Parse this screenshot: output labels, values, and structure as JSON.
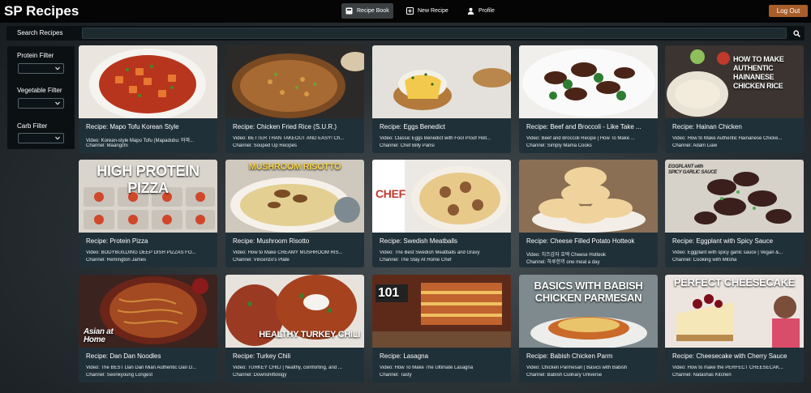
{
  "app": {
    "title": "SP Recipes"
  },
  "nav": {
    "recipe_book": "Recipe Book",
    "new_recipe": "New Recipe",
    "profile": "Profile",
    "logout": "Log Out"
  },
  "search": {
    "label": "Search Recipes",
    "value": "",
    "placeholder": ""
  },
  "filters": [
    {
      "label": "Protein Filter",
      "value": ""
    },
    {
      "label": "Vegetable Filter",
      "value": ""
    },
    {
      "label": "Carb Filter",
      "value": ""
    }
  ],
  "colors": {
    "header": "#050505",
    "panel": "#0b1013",
    "card_info": "#203039",
    "logout": "#a85e2a",
    "active_nav": "#3a3f42"
  },
  "recipes": [
    {
      "title": "Recipe: Mapo Tofu Korean Style",
      "video": "Video: Korean-style Mapo Tofu (Mapadubu: 마파...",
      "channel": "Channel: Maangchi",
      "thumb_text": ""
    },
    {
      "title": "Recipe: Chicken Fried Rice (S.U.R.)",
      "video": "Video: BETTER THAN TAKEOUT AND EASY! Ch...",
      "channel": "Channel: Souped Up Recipes",
      "thumb_text": ""
    },
    {
      "title": "Recipe: Eggs Benedict",
      "video": "Video: Classic Eggs Benedict with Fool Proof Holl...",
      "channel": "Channel: Chef Billy Parisi",
      "thumb_text": ""
    },
    {
      "title": "Recipe: Beef and Broccoli - Like Take ...",
      "video": "Video: Beef and Broccoli Recipe | How To Make ...",
      "channel": "Channel: Simply Mama Cooks",
      "thumb_text": ""
    },
    {
      "title": "Recipe: Hainan Chicken",
      "video": "Video: How to Make Authentic Hainanese Chicke...",
      "channel": "Channel: Adam Liaw",
      "thumb_text": "HOW TO MAKE AUTHENTIC HAINANESE CHICKEN RICE"
    },
    {
      "title": "Recipe: Protein Pizza",
      "video": "Video: BODYBUILDING DEEP DISH PIZZAS FO...",
      "channel": "Channel: Remington James",
      "thumb_text": "HIGH PROTEIN PIZZA"
    },
    {
      "title": "Recipe: Mushroom Risotto",
      "video": "Video: How to Make CREAMY MUSHROOM RIS...",
      "channel": "Channel: Vincenzo's Plate",
      "thumb_text": "MUSHROOM RISOTTO"
    },
    {
      "title": "Recipe: Swedish Meatballs",
      "video": "Video: The Best Swedish Meatballs and Gravy",
      "channel": "Channel: The Stay At Home Chef",
      "thumb_text": "CHEF"
    },
    {
      "title": "Recipe: Cheese Filled Potato Hotteok",
      "video": "Video: 치즈감자 호떡 Cheese Hotteok",
      "channel": "Channel: 하루한끼 one meal a day",
      "thumb_text": ""
    },
    {
      "title": "Recipe: Eggplant with Spicy Sauce",
      "video": "Video: Eggplant with spicy garlic sauce | Vegan &...",
      "channel": "Channel: Cooking with Mitsha",
      "thumb_text": "EGGPLANT with SPICY GARLIC SAUCE"
    },
    {
      "title": "Recipe: Dan Dan Noodles",
      "video": "Video: The BEST Dan Dan Mian Authentic Dan D...",
      "channel": "Channel: Seonkyoung Longest",
      "thumb_text": "Asian at Home"
    },
    {
      "title": "Recipe: Turkey Chili",
      "video": "Video: TURKEY CHILI | healthy, comforting, and ...",
      "channel": "Channel: Downshiftology",
      "thumb_text": "HEALTHY TURKEY CHILI"
    },
    {
      "title": "Recipe: Lasagna",
      "video": "Video: How To Make The Ultimate Lasagna",
      "channel": "Channel: Tasty",
      "thumb_text": "101"
    },
    {
      "title": "Recipe: Babish Chicken Parm",
      "video": "Video: Chicken Parmesan | Basics with Babish",
      "channel": "Channel: Babish Culinary Universe",
      "thumb_text": "BASICS WITH BABISH CHICKEN PARMESAN"
    },
    {
      "title": "Recipe: Cheesecake with Cherry Sauce",
      "video": "Video: How to make the PERFECT CHEESECAK...",
      "channel": "Channel: Natashas Kitchen",
      "thumb_text": "PERFECT CHEESECAKE"
    }
  ]
}
